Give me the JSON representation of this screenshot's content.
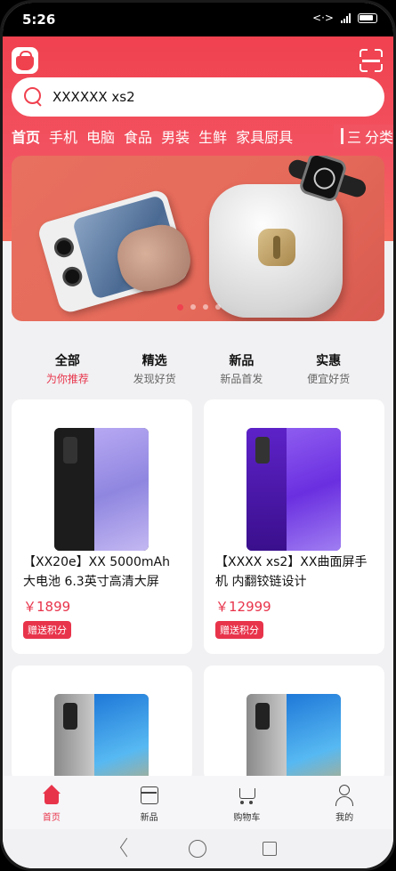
{
  "status": {
    "time": "5:26"
  },
  "search": {
    "query": "XXXXXX xs2"
  },
  "categories": [
    "首页",
    "手机",
    "电脑",
    "食品",
    "男装",
    "生鲜",
    "家具厨具"
  ],
  "categories_more": "分类",
  "banner": {
    "dots": 4,
    "active_dot": 0
  },
  "filters": [
    {
      "title": "全部",
      "sub": "为你推荐"
    },
    {
      "title": "精选",
      "sub": "发现好货"
    },
    {
      "title": "新品",
      "sub": "新品首发"
    },
    {
      "title": "实惠",
      "sub": "便宜好货"
    }
  ],
  "products": [
    {
      "title": "【XX20e】XX 5000mAh 大电池 6.3英寸高清大屏",
      "price": "￥1899",
      "badge": "赠送积分",
      "screen_color": "#9b8fe6"
    },
    {
      "title": "【XXXX xs2】XX曲面屏手机 内翻铰链设计",
      "price": "￥12999",
      "badge": "赠送积分",
      "screen_color": "#7b3de0"
    },
    {
      "title": "",
      "price": "",
      "badge": "",
      "screen_color": "#4aa8e8"
    },
    {
      "title": "",
      "price": "",
      "badge": "",
      "screen_color": "#4aa8e8"
    }
  ],
  "tabbar": [
    {
      "label": "首页",
      "icon": "home-icon"
    },
    {
      "label": "新品",
      "icon": "box-icon"
    },
    {
      "label": "购物车",
      "icon": "cart-icon"
    },
    {
      "label": "我的",
      "icon": "user-icon"
    }
  ],
  "colors": {
    "accent": "#e8344b",
    "header": "#f0414f"
  }
}
